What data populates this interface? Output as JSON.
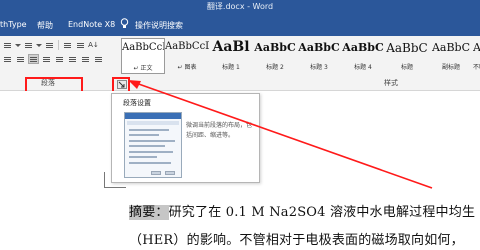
{
  "window": {
    "title": "翻译.docx  -  Word"
  },
  "menu": {
    "tabs": [
      "thType",
      "帮助",
      "EndNote X8"
    ],
    "tell_me": "操作说明搜索"
  },
  "ribbon": {
    "paragraph_group_label": "段落",
    "styles_group_label": "样式",
    "styles": [
      {
        "sample": "AaBbCcI",
        "name": "↵ 正文"
      },
      {
        "sample": "AaBbCcD",
        "name": "↵ 图表"
      },
      {
        "sample": "AaBl",
        "name": "标题 1"
      },
      {
        "sample": "AaBbC",
        "name": "标题 2"
      },
      {
        "sample": "AaBbC",
        "name": "标题 3"
      },
      {
        "sample": "AaBbC",
        "name": "标题 4"
      },
      {
        "sample": "AaBbC",
        "name": "标题"
      },
      {
        "sample": "AaBbC",
        "name": "副标题"
      },
      {
        "sample": "Aa",
        "name": "不明显"
      }
    ],
    "sort_glyph": "A↓"
  },
  "tooltip": {
    "title": "段落设置",
    "description": "微调当前段落的布局，包括间距、缩进等。"
  },
  "document": {
    "line1_highlight": "摘要：",
    "line1_rest": "研究了在 0.1 M Na2SO4 溶液中水电解过程中均生",
    "line2": "（HER）的影响。不管相对于电极表面的磁场取向如何，"
  },
  "colors": {
    "accent": "#2b579a",
    "annotation": "#ff1a1a",
    "highlight": "#c6c6c6"
  }
}
